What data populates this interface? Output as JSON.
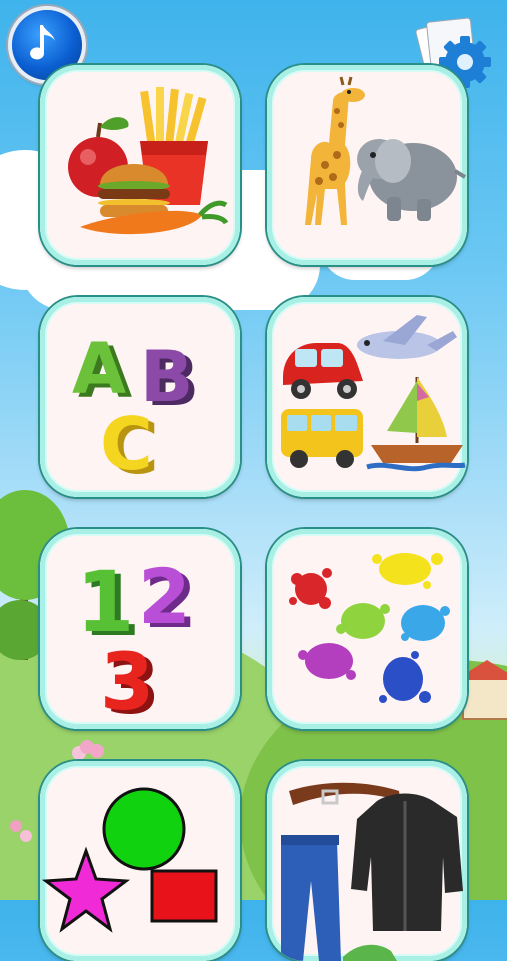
{
  "app": {
    "music_button": {
      "icon": "music-note-icon"
    },
    "settings_button": {
      "icon": "gear-icon"
    }
  },
  "categories": [
    {
      "id": "food",
      "icon": "food-icon"
    },
    {
      "id": "animals",
      "icon": "animals-icon"
    },
    {
      "id": "letters",
      "icon": "letters-icon",
      "glyphs": [
        "A",
        "B",
        "C"
      ]
    },
    {
      "id": "vehicles",
      "icon": "vehicles-icon"
    },
    {
      "id": "numbers",
      "icon": "numbers-icon",
      "glyphs": [
        "1",
        "2",
        "3"
      ]
    },
    {
      "id": "colors",
      "icon": "paint-splash-icon"
    },
    {
      "id": "shapes",
      "icon": "shapes-icon"
    },
    {
      "id": "clothes",
      "icon": "clothes-icon"
    }
  ],
  "colors": {
    "tile_border": "#2a8f86",
    "tile_inner": "#a8f0e6",
    "tile_bg": "#fff4f4",
    "sky": "#3fb3ec",
    "grass": "#86c64f"
  }
}
